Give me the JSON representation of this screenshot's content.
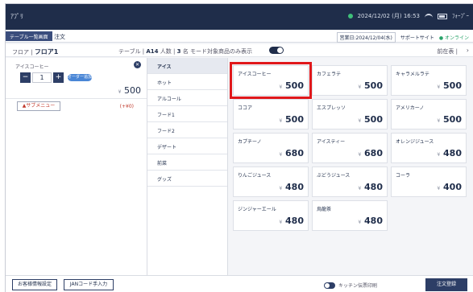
{
  "status_bar": {
    "app_name": "ｱﾌﾟﾘ",
    "datetime": "2024/12/02 (月) 16:53",
    "device": "ﾌｫｰﾌﾟｰ"
  },
  "header": {
    "breadcrumb": "テーブル一覧画面",
    "page_title": "注文",
    "business_date": "営業日:2024/12/04(水)",
    "support_site": "サポートサイト",
    "connection": "● オンライン"
  },
  "floor_row": {
    "floor_label": "フロア | ",
    "floor_value": "フロア1",
    "table_label": "テーブル | ",
    "table_value": "A14",
    "people_label": "  人数 | ",
    "people_value": "3",
    "people_unit": "名",
    "filter_label": "モード対象商品のみ表示",
    "pager": "前在表 |"
  },
  "order_item": {
    "name": "アイスコーヒー",
    "quantity": "1",
    "option_pill": "オーダー追加",
    "price_prefix": "¥",
    "price": "500",
    "submenu_button": "▲サブメニュー",
    "submenu_total": "(+¥0)"
  },
  "categories": [
    "アイス",
    "ホット",
    "アルコール",
    "フード1",
    "フード2",
    "デザート",
    "前菜",
    "グッズ"
  ],
  "products": [
    {
      "name": "アイスコーヒー",
      "price": "500"
    },
    {
      "name": "カフェラテ",
      "price": "500"
    },
    {
      "name": "キャラメルラテ",
      "price": "500"
    },
    {
      "name": "ココア",
      "price": "500"
    },
    {
      "name": "エスプレッソ",
      "price": "500"
    },
    {
      "name": "アメリカーノ",
      "price": "500"
    },
    {
      "name": "カプチーノ",
      "price": "680"
    },
    {
      "name": "アイスティー",
      "price": "680"
    },
    {
      "name": "オレンジジュース",
      "price": "480"
    },
    {
      "name": "りんごジュース",
      "price": "480"
    },
    {
      "name": "ぶどうジュース",
      "price": "480"
    },
    {
      "name": "コーラ",
      "price": "400"
    },
    {
      "name": "ジンジャーエール",
      "price": "480"
    },
    {
      "name": "烏龍茶",
      "price": "480"
    }
  ],
  "price_prefix": "¥",
  "footer": {
    "customer_info": "お客様情報設定",
    "jan_input": "JANコード手入力",
    "kitchen_label": "キッチン伝票印刷",
    "register": "注文登録"
  },
  "colors": {
    "header_bg": "#1f2d4a",
    "accent": "#2d3e66",
    "highlight": "#e0181b"
  }
}
